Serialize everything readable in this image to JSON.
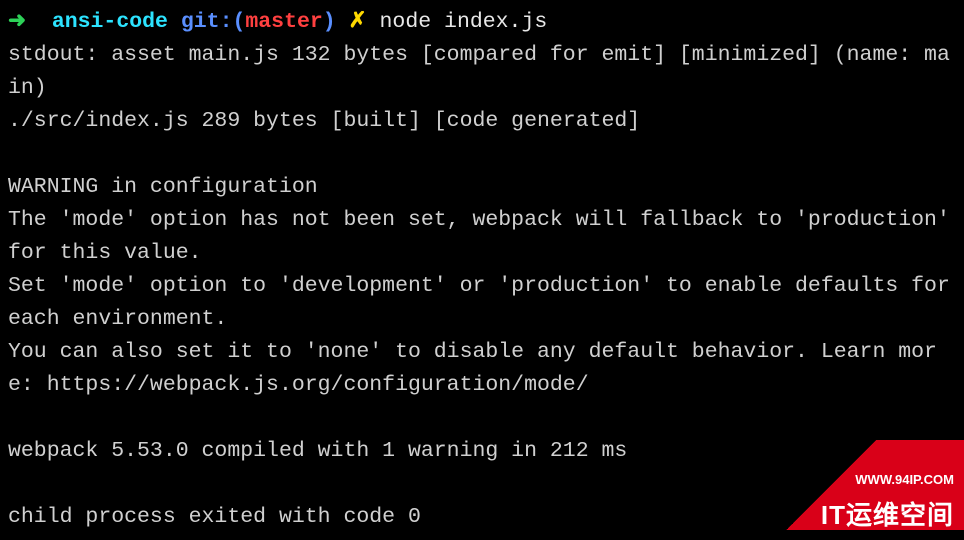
{
  "prompt": {
    "arrow": "➜",
    "dir": "ansi-code",
    "git_label": "git:(",
    "branch": "master",
    "git_close": ")",
    "dirty": "✗",
    "command": "node index.js"
  },
  "output": {
    "line1": "stdout: asset main.js 132 bytes [compared for emit] [minimized] (name: main)",
    "line2": "./src/index.js 289 bytes [built] [code generated]",
    "blank1": "",
    "warn_head": "WARNING in configuration",
    "warn_l1": "The 'mode' option has not been set, webpack will fallback to 'production' for this value.",
    "warn_l2": "Set 'mode' option to 'development' or 'production' to enable defaults for each environment.",
    "warn_l3": "You can also set it to 'none' to disable any default behavior. Learn more: https://webpack.js.org/configuration/mode/",
    "blank2": "",
    "compile": "webpack 5.53.0 compiled with 1 warning in 212 ms",
    "blank3": "",
    "exit": "child process exited with code 0"
  },
  "watermark": {
    "url": "WWW.94IP.COM",
    "text": "IT运维空间"
  }
}
